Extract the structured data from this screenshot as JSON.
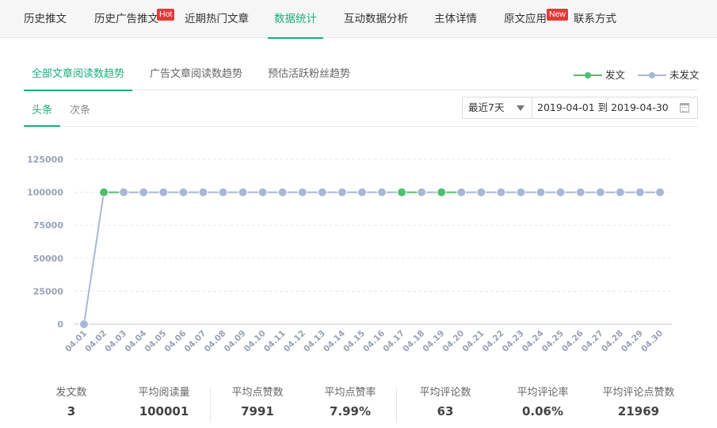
{
  "topnav": {
    "items": [
      {
        "label": "历史推文"
      },
      {
        "label": "历史广告推文",
        "badge": "Hot"
      },
      {
        "label": "近期热门文章"
      },
      {
        "label": "数据统计"
      },
      {
        "label": "互动数据分析"
      },
      {
        "label": "主体详情"
      },
      {
        "label": "原文应用",
        "badge": "New"
      },
      {
        "label": "联系方式"
      }
    ]
  },
  "subtabs": [
    "全部文章阅读数趋势",
    "广告文章阅读数趋势",
    "预估活跃粉丝趋势"
  ],
  "legend": [
    {
      "label": "发文",
      "color": "#4cc06e"
    },
    {
      "label": "未发文",
      "color": "#a8b8d4"
    }
  ],
  "tabs2": [
    "头条",
    "次条"
  ],
  "range": {
    "selected": "最近7天"
  },
  "daterange": {
    "text": "2019-04-01 到 2019-04-30"
  },
  "chart_data": {
    "type": "line",
    "x": [
      "04.01",
      "04.02",
      "04.03",
      "04.04",
      "04.05",
      "04.06",
      "04.07",
      "04.08",
      "04.09",
      "04.10",
      "04.11",
      "04.12",
      "04.13",
      "04.14",
      "04.15",
      "04.16",
      "04.17",
      "04.18",
      "04.19",
      "04.20",
      "04.21",
      "04.22",
      "04.23",
      "04.24",
      "04.25",
      "04.26",
      "04.27",
      "04.28",
      "04.29",
      "04.30"
    ],
    "values": [
      0,
      100000,
      100000,
      100000,
      100000,
      100000,
      100000,
      100000,
      100000,
      100000,
      100000,
      100000,
      100000,
      100000,
      100000,
      100000,
      100000,
      100000,
      100000,
      100000,
      100000,
      100000,
      100000,
      100000,
      100000,
      100000,
      100000,
      100000,
      100000,
      100000
    ],
    "published": [
      false,
      true,
      false,
      false,
      false,
      false,
      false,
      false,
      false,
      false,
      false,
      false,
      false,
      false,
      false,
      false,
      true,
      false,
      true,
      false,
      false,
      false,
      false,
      false,
      false,
      false,
      false,
      false,
      false,
      false
    ],
    "yticks": [
      0,
      25000,
      50000,
      75000,
      100000,
      125000
    ],
    "ylim": [
      0,
      125000
    ],
    "grid": true,
    "colors": {
      "published": "#4cc06e",
      "unpublished": "#a8b8d4"
    }
  },
  "stats": [
    {
      "title": "发文数",
      "value": "3"
    },
    {
      "title": "平均阅读量",
      "value": "100001"
    },
    {
      "title": "平均点赞数",
      "value": "7991"
    },
    {
      "title": "平均点赞率",
      "value": "7.99%"
    },
    {
      "title": "平均评论数",
      "value": "63"
    },
    {
      "title": "平均评论率",
      "value": "0.06%"
    },
    {
      "title": "平均评论点赞数",
      "value": "21969"
    }
  ]
}
